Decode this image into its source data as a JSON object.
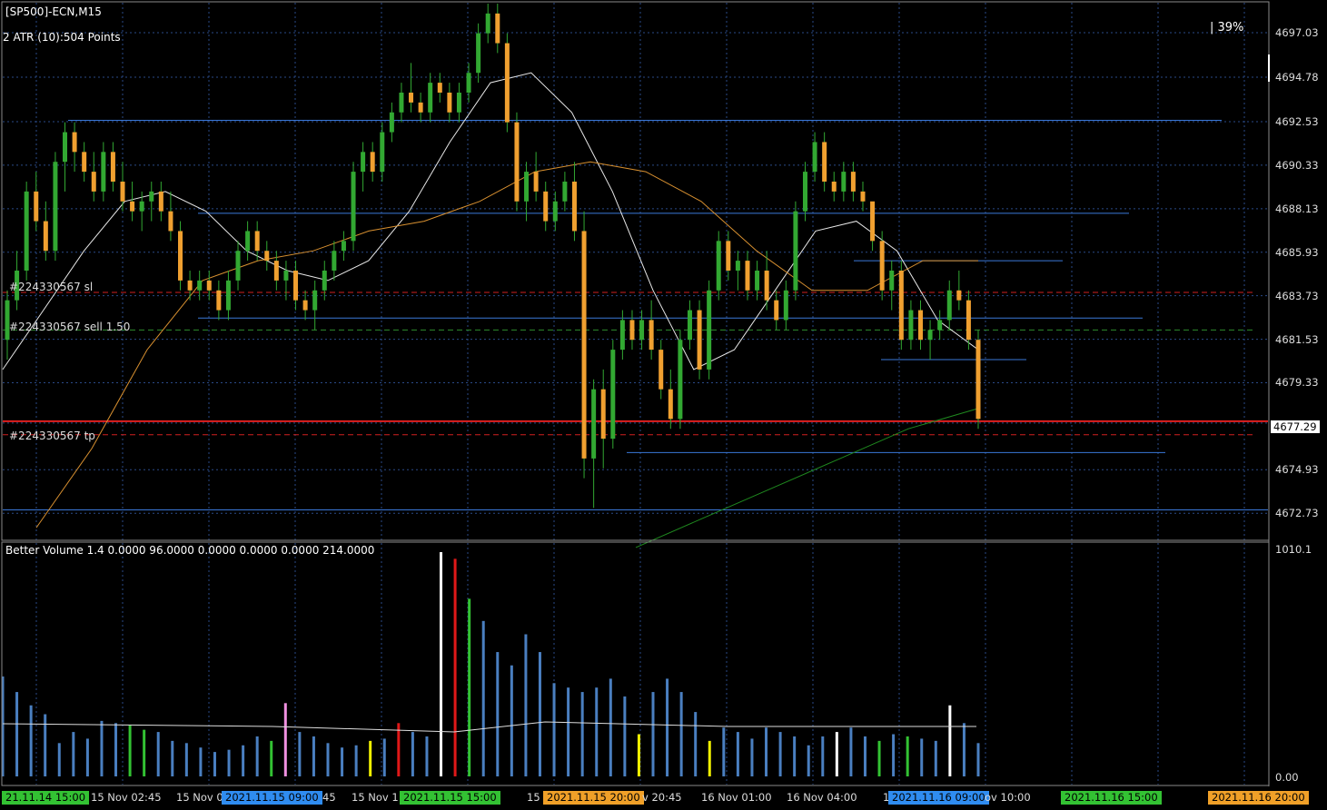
{
  "chart_title": "[SP500]-ECN,M15",
  "atr_label": "2 ATR (10):504 Points",
  "percent_label": "39%",
  "order_labels": {
    "sl": "#224330567 sl",
    "sell": "#224330567 sell 1.50",
    "tp": "#224330567 tp"
  },
  "volume_label": "Better Volume 1.4 0.0000 96.0000 0.0000 0.0000 0.0000 214.0000",
  "current_price": "4677.29",
  "price_axis": [
    "4697.03",
    "4694.78",
    "4692.53",
    "4690.33",
    "4688.13",
    "4685.93",
    "4683.73",
    "4681.53",
    "4679.33",
    "4677.29",
    "4674.93",
    "4672.73"
  ],
  "volume_axis": [
    "1010.1",
    "0.00"
  ],
  "time_axis": [
    {
      "text": "21.11.14 15:00",
      "style": "green"
    },
    {
      "text": "15 Nov 02:45",
      "style": "plain"
    },
    {
      "text": "15 Nov 0",
      "style": "plain"
    },
    {
      "text": "2021.11.15 09:00",
      "style": "blue"
    },
    {
      "text": "45",
      "style": "plain"
    },
    {
      "text": "15 Nov 1",
      "style": "plain"
    },
    {
      "text": "2021.11.15 15:00",
      "style": "green"
    },
    {
      "text": "15",
      "style": "plain"
    },
    {
      "text": "2021.11.15 20:00",
      "style": "orange"
    },
    {
      "text": "v 20:45",
      "style": "plain"
    },
    {
      "text": "16 Nov 01:00",
      "style": "plain"
    },
    {
      "text": "16 Nov 04:00",
      "style": "plain"
    },
    {
      "text": "16",
      "style": "plain"
    },
    {
      "text": "2021.11.16 09:00",
      "style": "blue"
    },
    {
      "text": "ov 10:00",
      "style": "plain"
    },
    {
      "text": "2021.11.16 15:00",
      "style": "green"
    },
    {
      "text": "2021.11.16 20:00",
      "style": "orange"
    }
  ],
  "colors": {
    "background": "#000000",
    "bull": "#32a832",
    "bear": "#f0a030",
    "grid": "#2e4d8a",
    "level_blue": "#3a78d8",
    "sl_red": "#d02020",
    "ma_white": "#e8e8e8",
    "ma_orange": "#d89030",
    "ma_green": "#1f8a1f",
    "vol_blue": "#4a7fc0",
    "vol_green": "#33c233",
    "vol_red": "#e01818",
    "vol_white": "#ffffff",
    "vol_yellow": "#f0f000",
    "vol_pink": "#f090e0"
  },
  "chart_data": {
    "type": "candlestick",
    "symbol": "[SP500]-ECN",
    "timeframe": "M15",
    "ylim": [
      4671.5,
      4698.5
    ],
    "candles": [
      [
        4681.5,
        4684.0,
        4680.5,
        4683.5
      ],
      [
        4683.5,
        4686.0,
        4683.0,
        4685.0
      ],
      [
        4685.0,
        4689.5,
        4684.5,
        4689.0
      ],
      [
        4689.0,
        4690.0,
        4687.0,
        4687.5
      ],
      [
        4687.5,
        4688.5,
        4685.5,
        4686.0
      ],
      [
        4686.0,
        4691.0,
        4685.5,
        4690.5
      ],
      [
        4690.5,
        4692.5,
        4689.0,
        4692.0
      ],
      [
        4692.0,
        4692.5,
        4690.0,
        4691.0
      ],
      [
        4691.0,
        4691.5,
        4689.5,
        4690.0
      ],
      [
        4690.0,
        4691.0,
        4688.5,
        4689.0
      ],
      [
        4689.0,
        4691.5,
        4688.5,
        4691.0
      ],
      [
        4691.0,
        4691.5,
        4689.0,
        4689.5
      ],
      [
        4689.5,
        4690.5,
        4688.0,
        4688.5
      ],
      [
        4688.5,
        4689.5,
        4687.5,
        4688.0
      ],
      [
        4688.0,
        4689.0,
        4687.0,
        4688.5
      ],
      [
        4688.5,
        4689.5,
        4687.5,
        4689.0
      ],
      [
        4689.0,
        4689.5,
        4687.5,
        4688.0
      ],
      [
        4688.0,
        4689.0,
        4686.5,
        4687.0
      ],
      [
        4687.0,
        4687.5,
        4684.0,
        4684.5
      ],
      [
        4684.5,
        4685.0,
        4683.5,
        4684.0
      ],
      [
        4684.0,
        4685.0,
        4683.5,
        4684.5
      ],
      [
        4684.5,
        4685.0,
        4683.5,
        4684.0
      ],
      [
        4684.0,
        4684.5,
        4682.5,
        4683.0
      ],
      [
        4683.0,
        4685.0,
        4682.5,
        4684.5
      ],
      [
        4684.5,
        4686.5,
        4684.0,
        4686.0
      ],
      [
        4686.0,
        4687.5,
        4685.5,
        4687.0
      ],
      [
        4687.0,
        4687.5,
        4685.5,
        4686.0
      ],
      [
        4686.0,
        4686.5,
        4685.0,
        4685.5
      ],
      [
        4685.5,
        4686.0,
        4684.0,
        4684.5
      ],
      [
        4684.5,
        4685.5,
        4683.5,
        4685.0
      ],
      [
        4685.0,
        4685.5,
        4683.0,
        4683.5
      ],
      [
        4683.5,
        4684.0,
        4682.5,
        4683.0
      ],
      [
        4683.0,
        4684.5,
        4682.0,
        4684.0
      ],
      [
        4684.0,
        4685.5,
        4683.5,
        4685.0
      ],
      [
        4685.0,
        4686.5,
        4684.5,
        4686.0
      ],
      [
        4686.0,
        4687.0,
        4685.5,
        4686.5
      ],
      [
        4686.5,
        4690.5,
        4686.0,
        4690.0
      ],
      [
        4690.0,
        4691.5,
        4689.0,
        4691.0
      ],
      [
        4691.0,
        4691.5,
        4689.5,
        4690.0
      ],
      [
        4690.0,
        4692.5,
        4689.5,
        4692.0
      ],
      [
        4692.0,
        4693.5,
        4691.5,
        4693.0
      ],
      [
        4693.0,
        4694.5,
        4692.5,
        4694.0
      ],
      [
        4694.0,
        4695.5,
        4693.0,
        4693.5
      ],
      [
        4693.5,
        4694.0,
        4692.5,
        4693.0
      ],
      [
        4693.0,
        4695.0,
        4692.5,
        4694.5
      ],
      [
        4694.5,
        4695.0,
        4693.5,
        4694.0
      ],
      [
        4694.0,
        4694.5,
        4692.5,
        4693.0
      ],
      [
        4693.0,
        4694.5,
        4692.5,
        4694.0
      ],
      [
        4694.0,
        4695.5,
        4693.5,
        4695.0
      ],
      [
        4695.0,
        4697.5,
        4694.5,
        4697.0
      ],
      [
        4697.0,
        4698.5,
        4696.5,
        4698.0
      ],
      [
        4698.0,
        4698.5,
        4696.0,
        4696.5
      ],
      [
        4696.5,
        4697.0,
        4692.0,
        4692.5
      ],
      [
        4692.5,
        4693.0,
        4688.0,
        4688.5
      ],
      [
        4688.5,
        4690.5,
        4687.5,
        4690.0
      ],
      [
        4690.0,
        4691.0,
        4688.5,
        4689.0
      ],
      [
        4689.0,
        4689.5,
        4687.0,
        4687.5
      ],
      [
        4687.5,
        4689.0,
        4687.0,
        4688.5
      ],
      [
        4688.5,
        4690.0,
        4688.0,
        4689.5
      ],
      [
        4689.5,
        4690.5,
        4686.5,
        4687.0
      ],
      [
        4687.0,
        4688.0,
        4674.5,
        4675.5
      ],
      [
        4675.5,
        4679.5,
        4673.0,
        4679.0
      ],
      [
        4679.0,
        4680.0,
        4675.0,
        4676.5
      ],
      [
        4676.5,
        4681.5,
        4676.0,
        4681.0
      ],
      [
        4681.0,
        4683.0,
        4680.5,
        4682.5
      ],
      [
        4682.5,
        4683.0,
        4681.0,
        4681.5
      ],
      [
        4681.5,
        4683.0,
        4681.0,
        4682.5
      ],
      [
        4682.5,
        4683.5,
        4680.5,
        4681.0
      ],
      [
        4681.0,
        4681.5,
        4678.5,
        4679.0
      ],
      [
        4679.0,
        4680.0,
        4677.0,
        4677.5
      ],
      [
        4677.5,
        4682.0,
        4677.0,
        4681.5
      ],
      [
        4681.5,
        4683.5,
        4681.0,
        4683.0
      ],
      [
        4683.0,
        4683.5,
        4679.5,
        4680.0
      ],
      [
        4680.0,
        4684.5,
        4679.5,
        4684.0
      ],
      [
        4684.0,
        4687.0,
        4683.5,
        4686.5
      ],
      [
        4686.5,
        4687.0,
        4684.5,
        4685.0
      ],
      [
        4685.0,
        4686.0,
        4684.0,
        4685.5
      ],
      [
        4685.5,
        4686.0,
        4683.5,
        4684.0
      ],
      [
        4684.0,
        4685.5,
        4683.5,
        4685.0
      ],
      [
        4685.0,
        4686.0,
        4683.0,
        4683.5
      ],
      [
        4683.5,
        4684.0,
        4682.0,
        4682.5
      ],
      [
        4682.5,
        4684.5,
        4682.0,
        4684.0
      ],
      [
        4684.0,
        4688.5,
        4683.5,
        4688.0
      ],
      [
        4688.0,
        4690.5,
        4687.5,
        4690.0
      ],
      [
        4690.0,
        4692.0,
        4689.5,
        4691.5
      ],
      [
        4691.5,
        4692.0,
        4689.0,
        4689.5
      ],
      [
        4689.5,
        4690.0,
        4688.5,
        4689.0
      ],
      [
        4689.0,
        4690.5,
        4688.5,
        4690.0
      ],
      [
        4690.0,
        4690.5,
        4688.5,
        4689.0
      ],
      [
        4689.0,
        4689.5,
        4688.0,
        4688.5
      ],
      [
        4688.5,
        4688.0,
        4686.0,
        4686.5
      ],
      [
        4686.5,
        4687.0,
        4683.5,
        4684.0
      ],
      [
        4684.0,
        4685.5,
        4683.0,
        4685.0
      ],
      [
        4685.0,
        4685.5,
        4681.0,
        4681.5
      ],
      [
        4681.5,
        4683.5,
        4681.0,
        4683.0
      ],
      [
        4683.0,
        4683.5,
        4681.0,
        4681.5
      ],
      [
        4681.5,
        4682.5,
        4680.5,
        4682.0
      ],
      [
        4682.0,
        4683.0,
        4681.5,
        4682.5
      ],
      [
        4682.5,
        4684.5,
        4682.0,
        4684.0
      ],
      [
        4684.0,
        4685.0,
        4683.0,
        4683.5
      ],
      [
        4683.5,
        4684.0,
        4681.0,
        4681.5
      ],
      [
        4681.5,
        4682.0,
        4677.0,
        4677.5
      ]
    ],
    "moving_averages": [
      {
        "color": "white",
        "points": [
          4680.0,
          4683.0,
          4686.0,
          4688.5,
          4689.0,
          4688.0,
          4686.0,
          4685.0,
          4684.5,
          4685.5,
          4688.0,
          4691.5,
          4694.5,
          4695.0,
          4693.0,
          4689.0,
          4684.0,
          4680.0,
          4681.0,
          4684.0,
          4687.0,
          4687.5,
          4686.0,
          4682.5,
          4681.0
        ]
      },
      {
        "color": "orange",
        "points": [
          4672.0,
          4676.0,
          4681.0,
          4684.5,
          4685.5,
          4686.0,
          4687.0,
          4687.5,
          4688.5,
          4690.0,
          4690.5,
          4690.0,
          4688.5,
          4686.0,
          4684.0,
          4684.0,
          4685.5,
          4685.5
        ]
      },
      {
        "color": "green",
        "points": [
          4671.0,
          4672.5,
          4674.0,
          4675.5,
          4677.0,
          4678.0
        ]
      }
    ],
    "levels": {
      "sl": 4683.9,
      "sell": 4682.0,
      "tp": 4676.7,
      "current_bid": 4677.29,
      "support_resistance": [
        4692.6,
        4687.9,
        4685.5,
        4682.6,
        4680.5,
        4675.8,
        4672.9
      ]
    },
    "volume": [
      {
        "v": 450,
        "c": "blue"
      },
      {
        "v": 380,
        "c": "blue"
      },
      {
        "v": 320,
        "c": "blue"
      },
      {
        "v": 280,
        "c": "blue"
      },
      {
        "v": 150,
        "c": "blue"
      },
      {
        "v": 200,
        "c": "blue"
      },
      {
        "v": 170,
        "c": "blue"
      },
      {
        "v": 250,
        "c": "blue"
      },
      {
        "v": 240,
        "c": "blue"
      },
      {
        "v": 230,
        "c": "green"
      },
      {
        "v": 210,
        "c": "green"
      },
      {
        "v": 200,
        "c": "blue"
      },
      {
        "v": 160,
        "c": "blue"
      },
      {
        "v": 150,
        "c": "blue"
      },
      {
        "v": 130,
        "c": "blue"
      },
      {
        "v": 110,
        "c": "blue"
      },
      {
        "v": 120,
        "c": "blue"
      },
      {
        "v": 140,
        "c": "blue"
      },
      {
        "v": 180,
        "c": "blue"
      },
      {
        "v": 160,
        "c": "green"
      },
      {
        "v": 330,
        "c": "pink"
      },
      {
        "v": 200,
        "c": "blue"
      },
      {
        "v": 180,
        "c": "blue"
      },
      {
        "v": 150,
        "c": "blue"
      },
      {
        "v": 130,
        "c": "blue"
      },
      {
        "v": 140,
        "c": "blue"
      },
      {
        "v": 160,
        "c": "yellow"
      },
      {
        "v": 170,
        "c": "blue"
      },
      {
        "v": 240,
        "c": "red"
      },
      {
        "v": 200,
        "c": "blue"
      },
      {
        "v": 180,
        "c": "blue"
      },
      {
        "v": 1010,
        "c": "white"
      },
      {
        "v": 980,
        "c": "red"
      },
      {
        "v": 800,
        "c": "green"
      },
      {
        "v": 700,
        "c": "blue"
      },
      {
        "v": 560,
        "c": "blue"
      },
      {
        "v": 500,
        "c": "blue"
      },
      {
        "v": 640,
        "c": "blue"
      },
      {
        "v": 560,
        "c": "blue"
      },
      {
        "v": 420,
        "c": "blue"
      },
      {
        "v": 400,
        "c": "blue"
      },
      {
        "v": 380,
        "c": "blue"
      },
      {
        "v": 400,
        "c": "blue"
      },
      {
        "v": 440,
        "c": "blue"
      },
      {
        "v": 360,
        "c": "blue"
      },
      {
        "v": 190,
        "c": "yellow"
      },
      {
        "v": 380,
        "c": "blue"
      },
      {
        "v": 440,
        "c": "blue"
      },
      {
        "v": 380,
        "c": "blue"
      },
      {
        "v": 290,
        "c": "blue"
      },
      {
        "v": 160,
        "c": "yellow"
      },
      {
        "v": 220,
        "c": "blue"
      },
      {
        "v": 200,
        "c": "blue"
      },
      {
        "v": 170,
        "c": "blue"
      },
      {
        "v": 220,
        "c": "blue"
      },
      {
        "v": 200,
        "c": "blue"
      },
      {
        "v": 180,
        "c": "blue"
      },
      {
        "v": 140,
        "c": "blue"
      },
      {
        "v": 180,
        "c": "blue"
      },
      {
        "v": 200,
        "c": "white"
      },
      {
        "v": 220,
        "c": "blue"
      },
      {
        "v": 180,
        "c": "blue"
      },
      {
        "v": 160,
        "c": "green"
      },
      {
        "v": 190,
        "c": "blue"
      },
      {
        "v": 180,
        "c": "green"
      },
      {
        "v": 170,
        "c": "blue"
      },
      {
        "v": 160,
        "c": "blue"
      },
      {
        "v": 320,
        "c": "white"
      },
      {
        "v": 240,
        "c": "blue"
      },
      {
        "v": 150,
        "c": "blue"
      }
    ]
  }
}
